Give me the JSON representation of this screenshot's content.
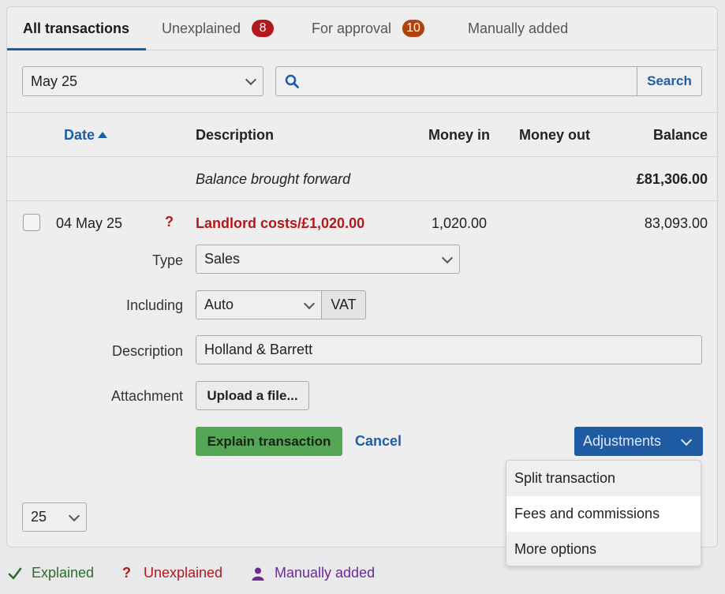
{
  "tabs": [
    {
      "label": "All transactions",
      "badge": ""
    },
    {
      "label": "Unexplained",
      "badge": "8"
    },
    {
      "label": "For approval",
      "badge": "10"
    },
    {
      "label": "Manually added",
      "badge": ""
    }
  ],
  "filter": {
    "month": "May 25",
    "search_button": "Search",
    "search_value": ""
  },
  "table": {
    "headers": {
      "date": "Date",
      "description": "Description",
      "money_in": "Money in",
      "money_out": "Money out",
      "balance": "Balance"
    },
    "brought_forward": {
      "label": "Balance brought forward",
      "balance": "£81,306.00"
    },
    "row": {
      "date": "04 May 25",
      "status_glyph": "?",
      "description": "Landlord costs/£1,020.00",
      "money_in": "1,020.00",
      "money_out": "",
      "balance": "83,093.00"
    }
  },
  "form": {
    "type_label": "Type",
    "type_value": "Sales",
    "including_label": "Including",
    "including_value": "Auto",
    "vat_label": "VAT",
    "description_label": "Description",
    "description_value": "Holland & Barrett",
    "attachment_label": "Attachment",
    "upload_label": "Upload a file...",
    "explain_label": "Explain transaction",
    "cancel_label": "Cancel",
    "adjustments_label": "Adjustments"
  },
  "adjustments_menu": [
    "Split transaction",
    "Fees and commissions",
    "More options"
  ],
  "pager": {
    "per_page": "25"
  },
  "legend": {
    "explained": "Explained",
    "unexplained": "Unexplained",
    "manual": "Manually added"
  },
  "colors": {
    "accent": "#1d5ea8",
    "explain_green": "#55a755",
    "unexplained_red": "#b3171c",
    "manual_purple": "#6a2c91",
    "explained_green": "#2d6b2d"
  }
}
